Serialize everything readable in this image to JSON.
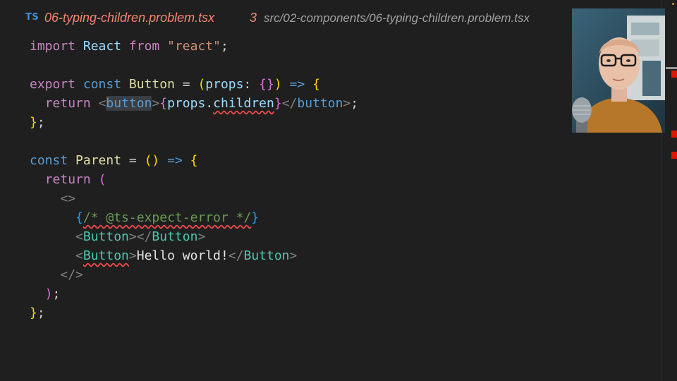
{
  "tab": {
    "lang_badge": "TS",
    "file_name": "06-typing-children.problem.tsx",
    "problem_count": "3",
    "path": "src/02-components/06-typing-children.problem.tsx"
  },
  "code": {
    "l1": {
      "a": "import",
      "b": "React",
      "c": "from",
      "d": "\"react\"",
      "e": ";"
    },
    "l3": {
      "a": "export",
      "b": "const",
      "c": "Button",
      "d": " = ",
      "e": "(",
      "f": "props",
      "g": ": ",
      "h": "{}",
      "i": ")",
      "j": " => ",
      "k": "{"
    },
    "l4": {
      "a": "return",
      "b": "<",
      "c": "button",
      "d": ">",
      "e": "{",
      "f": "props",
      "g": ".",
      "h": "children",
      "i": "}",
      "j": "</",
      "k": "button",
      "l": ">",
      "m": ";"
    },
    "l5": {
      "a": "}",
      "b": ";"
    },
    "l7": {
      "a": "const",
      "b": "Parent",
      "c": " = ",
      "d": "(",
      "e": ")",
      "f": " => ",
      "g": "{"
    },
    "l8": {
      "a": "return",
      "b": "("
    },
    "l9": {
      "a": "<>"
    },
    "l10": {
      "a": "{",
      "b": "/* @ts-expect-error */",
      "c": "}"
    },
    "l11": {
      "a": "<",
      "b": "Button",
      "c": "></",
      "d": "Button",
      "e": ">"
    },
    "l12": {
      "a": "<",
      "b": "Button",
      "c": ">",
      "d": "Hello world!",
      "e": "</",
      "f": "Button",
      "g": ">"
    },
    "l13": {
      "a": "</>"
    },
    "l14": {
      "a": ")",
      "b": ";"
    },
    "l15": {
      "a": "}",
      "b": ";"
    }
  },
  "colors": {
    "error": "#f14c4c",
    "keyword": "#c586c0",
    "component": "#4ec9b0",
    "tab_title": "#f48771"
  }
}
